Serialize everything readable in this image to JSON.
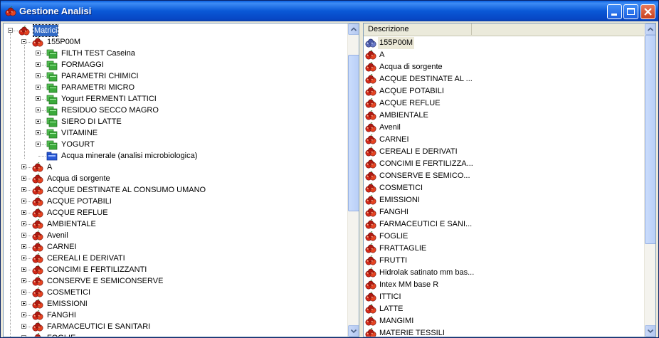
{
  "window": {
    "title": "Gestione Analisi",
    "app_icon": "apples-icon"
  },
  "tree": {
    "root": {
      "label": "Matrici",
      "expanded": true,
      "selected": true
    },
    "expanded_child": {
      "label": "155P00M",
      "expanded": true
    },
    "subfolders": [
      {
        "label": "FILTH TEST Caseina"
      },
      {
        "label": "FORMAGGI"
      },
      {
        "label": "PARAMETRI CHIMICI"
      },
      {
        "label": "PARAMETRI MICRO"
      },
      {
        "label": "Yogurt FERMENTI LATTICI"
      },
      {
        "label": "RESIDUO SECCO MAGRO"
      },
      {
        "label": "SIERO DI LATTE"
      },
      {
        "label": "VITAMINE"
      },
      {
        "label": "YOGURT"
      }
    ],
    "leaf": {
      "label": "Acqua minerale (analisi microbiologica)"
    },
    "matrices": [
      {
        "label": "A"
      },
      {
        "label": "Acqua di sorgente"
      },
      {
        "label": "ACQUE DESTINATE AL CONSUMO UMANO"
      },
      {
        "label": "ACQUE POTABILI"
      },
      {
        "label": "ACQUE REFLUE"
      },
      {
        "label": "AMBIENTALE"
      },
      {
        "label": "Avenil"
      },
      {
        "label": "CARNEI"
      },
      {
        "label": "CEREALI E DERIVATI"
      },
      {
        "label": "CONCIMI E FERTILIZZANTI"
      },
      {
        "label": "CONSERVE E SEMICONSERVE"
      },
      {
        "label": "COSMETICI"
      },
      {
        "label": "EMISSIONI"
      },
      {
        "label": "FANGHI"
      },
      {
        "label": "FARMACEUTICI E SANITARI"
      },
      {
        "label": "FOGLIE"
      }
    ]
  },
  "list": {
    "columns": [
      {
        "label": "Descrizione"
      },
      {
        "label": ""
      }
    ],
    "rows": [
      {
        "label": "155P00M",
        "selected": true
      },
      {
        "label": "A"
      },
      {
        "label": "Acqua di sorgente"
      },
      {
        "label": "ACQUE DESTINATE AL ..."
      },
      {
        "label": "ACQUE POTABILI"
      },
      {
        "label": "ACQUE REFLUE"
      },
      {
        "label": "AMBIENTALE"
      },
      {
        "label": "Avenil"
      },
      {
        "label": "CARNEI"
      },
      {
        "label": "CEREALI E DERIVATI"
      },
      {
        "label": "CONCIMI E FERTILIZZA..."
      },
      {
        "label": "CONSERVE E SEMICO..."
      },
      {
        "label": "COSMETICI"
      },
      {
        "label": "EMISSIONI"
      },
      {
        "label": "FANGHI"
      },
      {
        "label": "FARMACEUTICI E SANI..."
      },
      {
        "label": "FOGLIE"
      },
      {
        "label": "FRATTAGLIE"
      },
      {
        "label": "FRUTTI"
      },
      {
        "label": "Hidrolak satinato mm bas..."
      },
      {
        "label": "Intex MM base R"
      },
      {
        "label": "ITTICI"
      },
      {
        "label": "LATTE"
      },
      {
        "label": "MANGIMI"
      },
      {
        "label": "MATERIE TESSILI"
      }
    ]
  },
  "colors": {
    "titlebar": "#0a58d6",
    "selection": "#316ac5",
    "folder_green": "#2e9a2e",
    "apple_red": "#d42a1a"
  }
}
